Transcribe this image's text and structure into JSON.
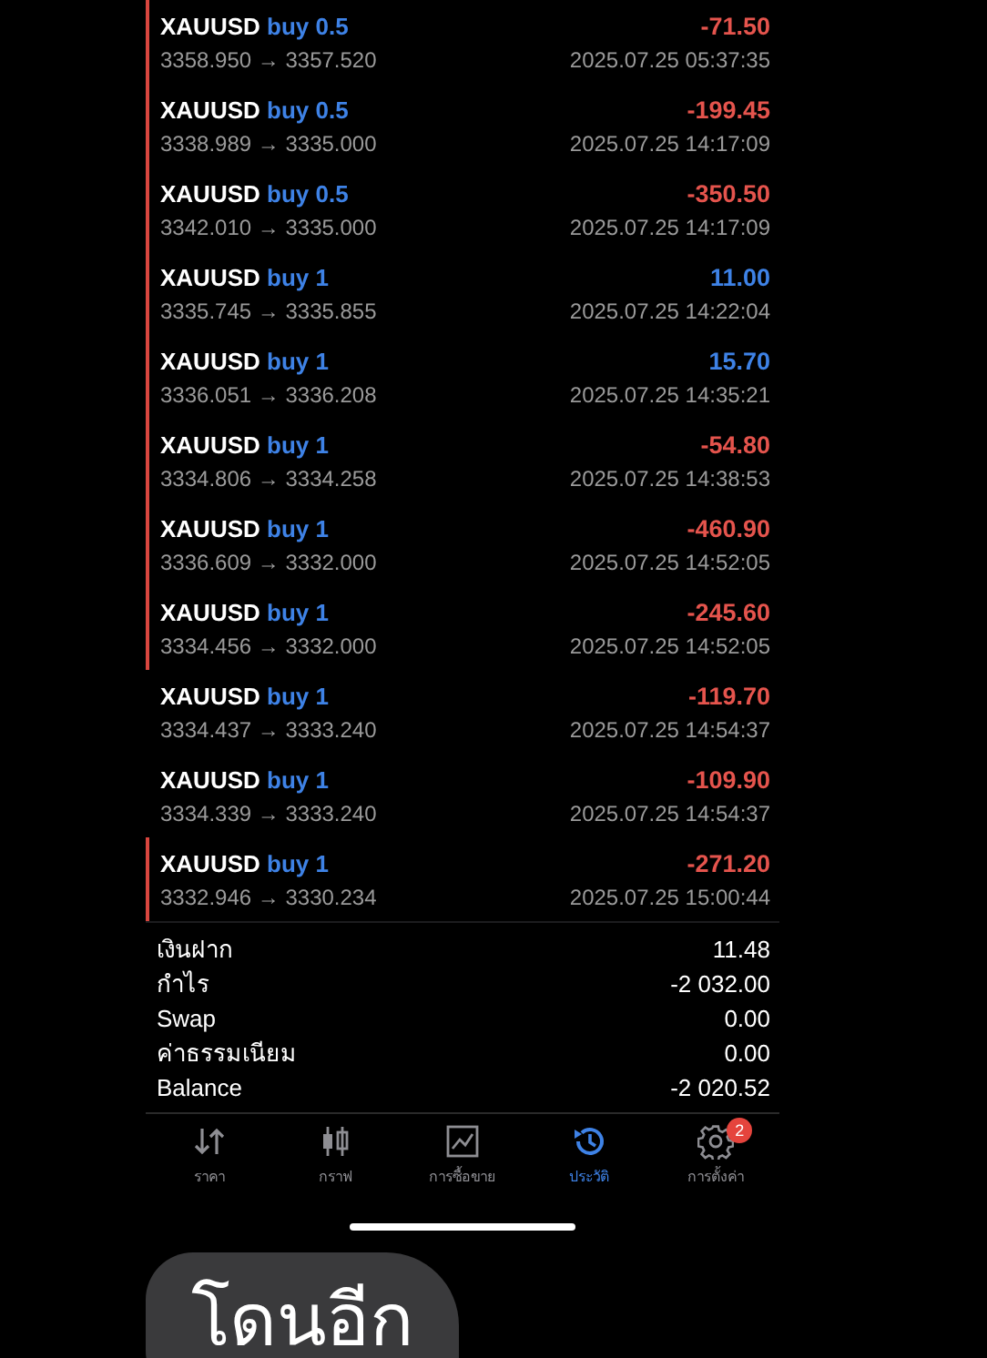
{
  "deals": [
    {
      "symbol": "XAUUSD",
      "side": "buy 0.5",
      "prices": "3358.950 → 3357.520",
      "profit": "-71.50",
      "gain": false,
      "time": "2025.07.25 05:37:35",
      "marked": true
    },
    {
      "symbol": "XAUUSD",
      "side": "buy 0.5",
      "prices": "3338.989 → 3335.000",
      "profit": "-199.45",
      "gain": false,
      "time": "2025.07.25 14:17:09",
      "marked": true
    },
    {
      "symbol": "XAUUSD",
      "side": "buy 0.5",
      "prices": "3342.010 → 3335.000",
      "profit": "-350.50",
      "gain": false,
      "time": "2025.07.25 14:17:09",
      "marked": true
    },
    {
      "symbol": "XAUUSD",
      "side": "buy 1",
      "prices": "3335.745 → 3335.855",
      "profit": "11.00",
      "gain": true,
      "time": "2025.07.25 14:22:04",
      "marked": true
    },
    {
      "symbol": "XAUUSD",
      "side": "buy 1",
      "prices": "3336.051 → 3336.208",
      "profit": "15.70",
      "gain": true,
      "time": "2025.07.25 14:35:21",
      "marked": true
    },
    {
      "symbol": "XAUUSD",
      "side": "buy 1",
      "prices": "3334.806 → 3334.258",
      "profit": "-54.80",
      "gain": false,
      "time": "2025.07.25 14:38:53",
      "marked": true
    },
    {
      "symbol": "XAUUSD",
      "side": "buy 1",
      "prices": "3336.609 → 3332.000",
      "profit": "-460.90",
      "gain": false,
      "time": "2025.07.25 14:52:05",
      "marked": true
    },
    {
      "symbol": "XAUUSD",
      "side": "buy 1",
      "prices": "3334.456 → 3332.000",
      "profit": "-245.60",
      "gain": false,
      "time": "2025.07.25 14:52:05",
      "marked": true
    },
    {
      "symbol": "XAUUSD",
      "side": "buy 1",
      "prices": "3334.437 → 3333.240",
      "profit": "-119.70",
      "gain": false,
      "time": "2025.07.25 14:54:37",
      "marked": false
    },
    {
      "symbol": "XAUUSD",
      "side": "buy 1",
      "prices": "3334.339 → 3333.240",
      "profit": "-109.90",
      "gain": false,
      "time": "2025.07.25 14:54:37",
      "marked": false
    },
    {
      "symbol": "XAUUSD",
      "side": "buy 1",
      "prices": "3332.946 → 3330.234",
      "profit": "-271.20",
      "gain": false,
      "time": "2025.07.25 15:00:44",
      "marked": true
    }
  ],
  "summary": [
    {
      "label": "เงินฝาก",
      "value": "11.48"
    },
    {
      "label": "กำไร",
      "value": "-2 032.00"
    },
    {
      "label": "Swap",
      "value": "0.00"
    },
    {
      "label": "ค่าธรรมเนียม",
      "value": "0.00"
    },
    {
      "label": "Balance",
      "value": "-2 020.52"
    }
  ],
  "tabs": [
    {
      "kind": "quotes",
      "label": "ราคา",
      "selected": false
    },
    {
      "kind": "chart",
      "label": "กราฟ",
      "selected": false
    },
    {
      "kind": "trade",
      "label": "การซื้อขาย",
      "selected": false
    },
    {
      "kind": "history",
      "label": "ประวัติ",
      "selected": true
    },
    {
      "kind": "settings",
      "label": "การตั้งค่า",
      "selected": false,
      "badge": "2"
    }
  ],
  "caption": "โดนอีก"
}
